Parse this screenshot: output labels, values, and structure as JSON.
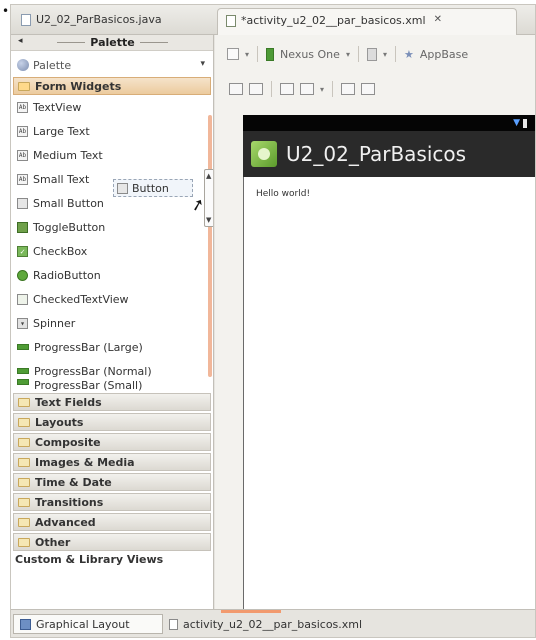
{
  "bullet": "•",
  "editor_tabs": [
    {
      "label": "U2_02_ParBasicos.java"
    },
    {
      "label": "*activity_u2_02__par_basicos.xml",
      "close": "✕"
    }
  ],
  "palette": {
    "header_title": "Palette",
    "header_arrow": "◂",
    "combo_value": "Palette",
    "combo_caret": "▾",
    "open_category": "Form Widgets",
    "widgets": [
      {
        "label": "TextView",
        "icon": "textview-icon"
      },
      {
        "label": "Large Text",
        "icon": "textview-icon"
      },
      {
        "label": "Medium Text",
        "icon": "textview-icon"
      },
      {
        "label": "Small Text",
        "icon": "textview-icon"
      },
      {
        "label": "Small Button",
        "icon": "button-icon"
      },
      {
        "label": "ToggleButton",
        "icon": "toggle-icon"
      },
      {
        "label": "CheckBox",
        "icon": "checkbox-icon"
      },
      {
        "label": "RadioButton",
        "icon": "radio-icon"
      },
      {
        "label": "CheckedTextView",
        "icon": "checked-text-icon"
      },
      {
        "label": "Spinner",
        "icon": "spinner-icon"
      },
      {
        "label": "ProgressBar (Large)",
        "icon": "progressbar-icon"
      },
      {
        "label": "ProgressBar (Normal)",
        "icon": "progressbar-icon"
      },
      {
        "label": "ProgressBar (Small)",
        "icon": "progressbar-icon"
      }
    ],
    "drag_item": "Button",
    "categories": [
      "Text Fields",
      "Layouts",
      "Composite",
      "Images & Media",
      "Time & Date",
      "Transitions",
      "Advanced",
      "Other"
    ],
    "custom_library": "Custom & Library Views"
  },
  "toolbar": {
    "device": "Nexus One",
    "theme": "AppBase",
    "caret": "▾",
    "star": "★"
  },
  "device_preview": {
    "app_title": "U2_02_ParBasicos",
    "hello_text": "Hello world!",
    "status_signal": "▼"
  },
  "bottom_tabs": [
    {
      "label": "Graphical Layout"
    },
    {
      "label": "activity_u2_02__par_basicos.xml"
    }
  ],
  "colors": {
    "accent_orange": "#f29a6e",
    "android_green": "#4f9c35",
    "action_bar": "#2a2a2a"
  }
}
